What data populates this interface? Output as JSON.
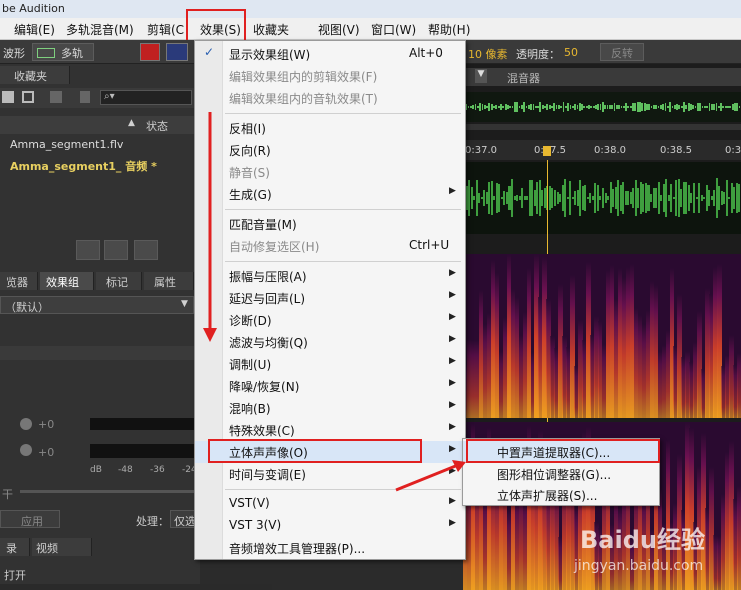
{
  "title_bar": {
    "text": "be Audition"
  },
  "menu_bar": {
    "items": [
      "编辑(E)",
      "多轨混音(M)",
      "剪辑(C",
      "效果(S)",
      "收藏夹",
      "视图(V)",
      "窗口(W)",
      "帮助(H)"
    ]
  },
  "toolbar": {
    "waveform_label": "波形",
    "multitrack_label": "多轨",
    "pixels_label": "10 像素",
    "opacity_label": "透明度：",
    "opacity_value": "50",
    "invert_label": "反转"
  },
  "left_panel": {
    "tabs": [
      "收藏夹"
    ],
    "columns": [
      "状态"
    ],
    "files": [
      "Amma_segment1.flv",
      "Amma_segment1_ 音频 *"
    ],
    "tabs2": [
      "览器",
      "效果组",
      "标记",
      "属性"
    ],
    "preset": "（默认）",
    "db_value_1": "+0",
    "db_value_2": "+0",
    "meter_ticks": [
      "dB",
      "-48",
      "-36",
      "-24"
    ],
    "dry_label": "干",
    "apply_label": "应用",
    "process_label": "处理：",
    "process_value": "仅选",
    "bottom_tabs": [
      "录",
      "视频"
    ],
    "open_label": "打开"
  },
  "editor": {
    "tab_mixer": "混音器",
    "timeline_labels": [
      "0:37.0",
      "0:37.5",
      "0:38.0",
      "0:38.5",
      "0:3"
    ]
  },
  "effects_menu": {
    "items": [
      {
        "label": "显示效果组(W)",
        "shortcut": "Alt+0",
        "checked": true
      },
      {
        "label": "编辑效果组内的剪辑效果(F)",
        "disabled": true
      },
      {
        "label": "编辑效果组内的音轨效果(T)",
        "disabled": true
      },
      {
        "label": "反相(I)"
      },
      {
        "label": "反向(R)"
      },
      {
        "label": "静音(S)",
        "disabled": true
      },
      {
        "label": "生成(G)",
        "submenu": true
      },
      {
        "label": "匹配音量(M)"
      },
      {
        "label": "自动修复选区(H)",
        "shortcut": "Ctrl+U",
        "disabled": true
      },
      {
        "label": "振幅与压限(A)",
        "submenu": true
      },
      {
        "label": "延迟与回声(L)",
        "submenu": true
      },
      {
        "label": "诊断(D)",
        "submenu": true
      },
      {
        "label": "滤波与均衡(Q)",
        "submenu": true
      },
      {
        "label": "调制(U)",
        "submenu": true
      },
      {
        "label": "降噪/恢复(N)",
        "submenu": true
      },
      {
        "label": "混响(B)",
        "submenu": true
      },
      {
        "label": "特殊效果(C)",
        "submenu": true
      },
      {
        "label": "立体声声像(O)",
        "submenu": true,
        "highlighted": true
      },
      {
        "label": "时间与变调(E)",
        "submenu": true
      },
      {
        "label": "VST(V)",
        "submenu": true
      },
      {
        "label": "VST 3(V)",
        "submenu": true
      },
      {
        "label": "音频增效工具管理器(P)..."
      }
    ],
    "arrow_glyph": "▶",
    "check_glyph": "✓"
  },
  "stereo_submenu": {
    "items": [
      "中置声道提取器(C)...",
      "图形相位调整器(G)...",
      "立体声扩展器(S)..."
    ]
  },
  "watermark": {
    "brand": "Baidu经验",
    "url": "jingyan.baidu.com"
  },
  "colors": {
    "highlight_red": "#e02020",
    "accent_yellow": "#e8b830",
    "wave_green": "#4caf50"
  }
}
